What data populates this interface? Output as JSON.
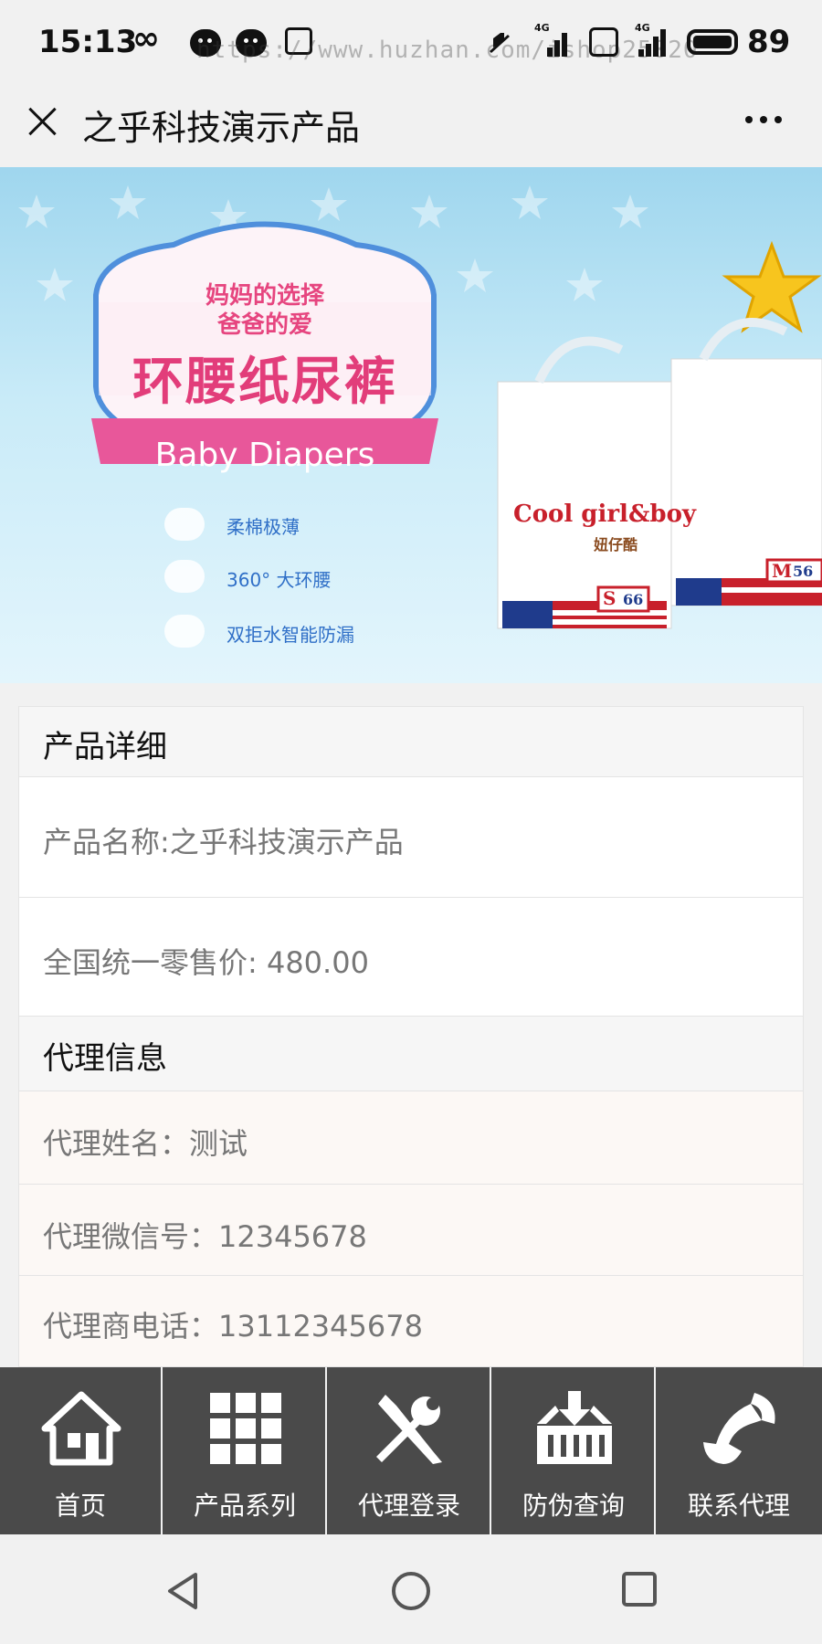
{
  "status_bar": {
    "time": "15:13",
    "infinity": "∞",
    "watermark": "https://www.huzhan.com/ishop25020",
    "battery": "89",
    "net_tag": "4G"
  },
  "header": {
    "title": "之乎科技演示产品"
  },
  "banner": {
    "badge_line1": "妈妈的选择",
    "badge_line2": "爸爸的爱",
    "badge_main": "环腰纸尿裤",
    "badge_ribbon": "Baby Diapers",
    "features": [
      "柔棉极薄",
      "360° 大环腰",
      "双拒水智能防漏"
    ],
    "pack_brand": "Cool girl&boy",
    "pack_sub": "妞仔酷",
    "pack_size_s": "S",
    "pack_count_s": "66",
    "pack_size_m": "M",
    "pack_count_m": "56"
  },
  "product_section": {
    "heading": "产品详细",
    "name_line": "产品名称:之乎科技演示产品",
    "price_line": "全国统一零售价: 480.00"
  },
  "agent_section": {
    "heading": "代理信息",
    "rows": [
      "代理姓名：测试",
      "代理微信号：12345678",
      "代理商电话：13112345678"
    ]
  },
  "bottom_nav": {
    "items": [
      {
        "label": "首页",
        "icon": "home-icon"
      },
      {
        "label": "产品系列",
        "icon": "grid-icon"
      },
      {
        "label": "代理登录",
        "icon": "tools-icon"
      },
      {
        "label": "防伪查询",
        "icon": "basket-icon"
      },
      {
        "label": "联系代理",
        "icon": "phone-icon"
      }
    ]
  },
  "colors": {
    "nav_bg": "#4a4a4a",
    "badge_pink": "#e23d7a",
    "banner_sky": "#9fd6ee"
  }
}
